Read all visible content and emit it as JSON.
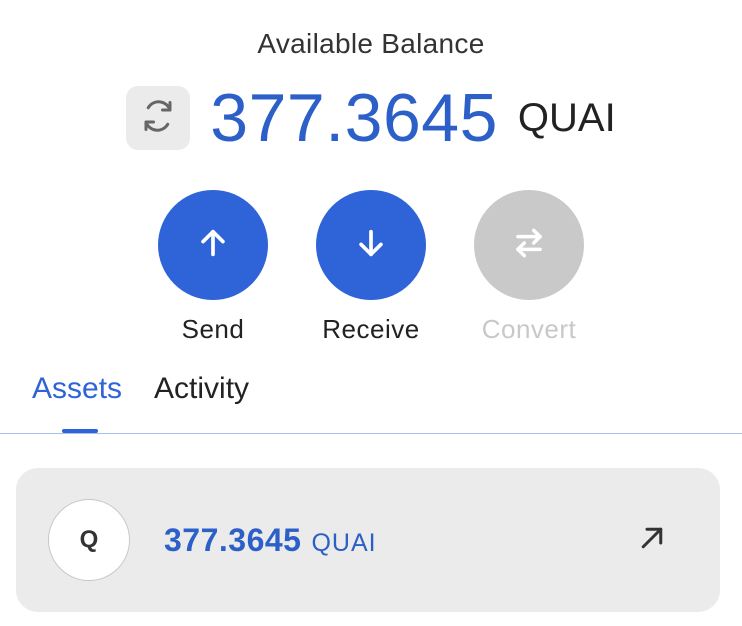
{
  "balance": {
    "title": "Available Balance",
    "amount": "377.3645",
    "unit": "QUAI"
  },
  "actions": [
    {
      "label": "Send",
      "icon": "arrow-up-icon",
      "enabled": true
    },
    {
      "label": "Receive",
      "icon": "arrow-down-icon",
      "enabled": true
    },
    {
      "label": "Convert",
      "icon": "swap-arrows-icon",
      "enabled": false
    }
  ],
  "tabs": [
    {
      "label": "Assets",
      "active": true
    },
    {
      "label": "Activity",
      "active": false
    }
  ],
  "assets": [
    {
      "avatar_letter": "Q",
      "amount": "377.3645",
      "unit": "QUAI",
      "action_icon": "arrow-up-right-icon"
    }
  ],
  "colors": {
    "accent": "#2f63d8",
    "balance_text": "#2d5fc8",
    "disabled": "#c9c9c9",
    "card_bg": "#ebebeb"
  }
}
